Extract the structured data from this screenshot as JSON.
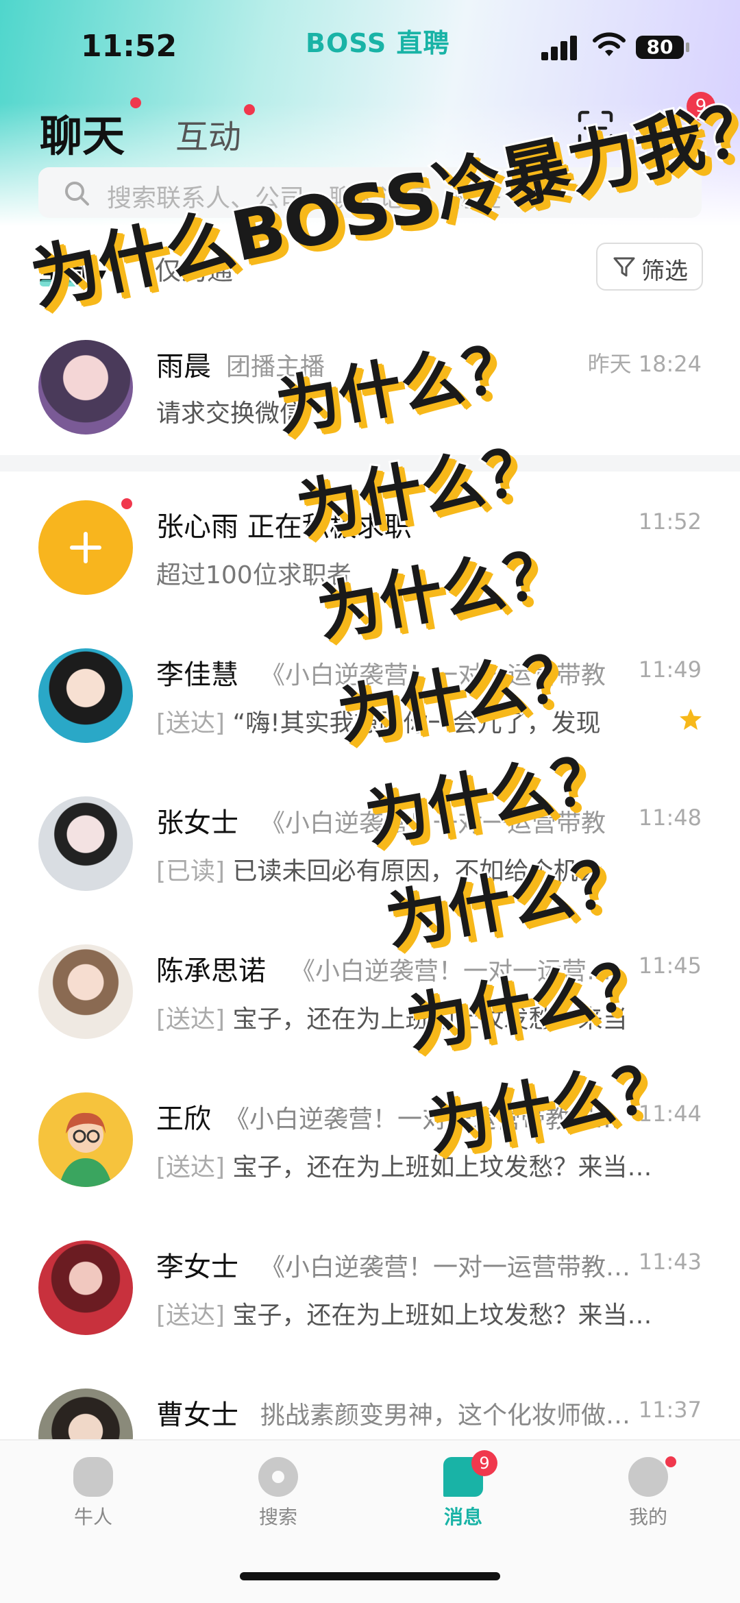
{
  "status_bar": {
    "time": "11:52",
    "brand": "BOSS 直聘",
    "battery": "80"
  },
  "header": {
    "tab_chat": "聊天",
    "tab_interact": "互动",
    "notifications_badge": "9"
  },
  "search": {
    "placeholder": "搜索联系人、公司、聊天记录、标签"
  },
  "filters": {
    "all": "全部",
    "second": "仅沟通",
    "filter_button": "筛选"
  },
  "chats": [
    {
      "name": "雨晨",
      "subtitle": "团播主播",
      "message": "请求交换微信",
      "status": "",
      "time": "昨天 18:24",
      "starred": false
    },
    {
      "name": "张心雨",
      "subtitle": "正在积极求职",
      "message": "超过100位求职者",
      "status": "",
      "time": "11:52",
      "starred": false
    },
    {
      "name": "李佳慧",
      "subtitle": "《小白逆袭营！一对一运营带教",
      "message": "“嗨!其实我想跟你一会儿了，发现",
      "status": "[送达]",
      "time": "11:49",
      "starred": true
    },
    {
      "name": "张女士",
      "subtitle": "《小白逆袭营！一对一运营带教",
      "message": "已读未回必有原因，不如给个机会",
      "status": "[已读]",
      "time": "11:48",
      "starred": false
    },
    {
      "name": "陈承思诺",
      "subtitle": "《小白逆袭营！一对一运营带教",
      "message": "宝子，还在为上班如上坟发愁？来当",
      "status": "[送达]",
      "time": "11:45",
      "starred": false
    },
    {
      "name": "王欣",
      "subtitle": "《小白逆袭营！一对一运营带教保…",
      "message": "宝子，还在为上班如上坟发愁？来当…",
      "status": "[送达]",
      "time": "11:44",
      "starred": false
    },
    {
      "name": "李女士",
      "subtitle": "《小白逆袭营！一对一运营带教…",
      "message": "宝子，还在为上班如上坟发愁？来当…",
      "status": "[送达]",
      "time": "11:43",
      "starred": false
    },
    {
      "name": "曹女士",
      "subtitle": "挑战素颜变男神，这个化妆师做…",
      "message": "",
      "status": "",
      "time": "11:37",
      "starred": false
    }
  ],
  "bottom_nav": [
    {
      "label": "牛人"
    },
    {
      "label": "搜索"
    },
    {
      "label": "消息",
      "badge": "9"
    },
    {
      "label": "我的"
    }
  ],
  "overlay": {
    "headline": "为什么BOSS冷暴力我？",
    "repeat": "为什么？"
  },
  "colors": {
    "accent": "#19b3a6",
    "badge": "#f0384d",
    "overlay_shadow": "#f7b81a",
    "star": "#f7b81a"
  }
}
